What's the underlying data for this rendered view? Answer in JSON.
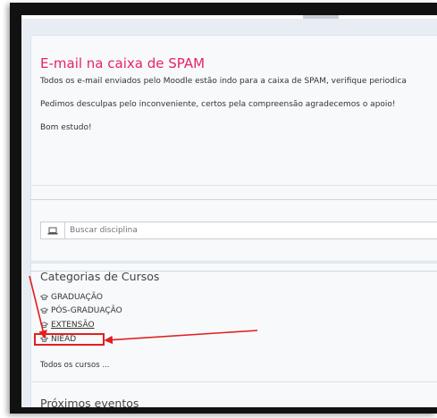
{
  "alert": {
    "title": "E-mail na caixa de SPAM",
    "line1": "Todos os e-mail enviados pelo Moodle estão indo para a caixa de SPAM, verifique periodica",
    "line2": "Pedimos desculpas pelo inconveniente, certos pela compreensão agradecemos o apoio!",
    "line3": "Bom estudo!"
  },
  "search": {
    "placeholder": "Buscar disciplina",
    "icon": "laptop-icon"
  },
  "categories": {
    "title": "Categorias de Cursos",
    "items": [
      {
        "label": "GRADUAÇÃO",
        "icon": "graduation-cap-icon"
      },
      {
        "label": "PÓS-GRADUAÇÃO",
        "icon": "graduation-cap-icon"
      },
      {
        "label": "EXTENSÃO",
        "icon": "graduation-cap-icon"
      },
      {
        "label": "NIEAD",
        "icon": "graduation-cap-icon"
      }
    ],
    "all": "Todos os cursos ..."
  },
  "events": {
    "title": "Próximos eventos"
  },
  "colors": {
    "alert_title": "#e8206b",
    "annotation": "#e02020"
  }
}
